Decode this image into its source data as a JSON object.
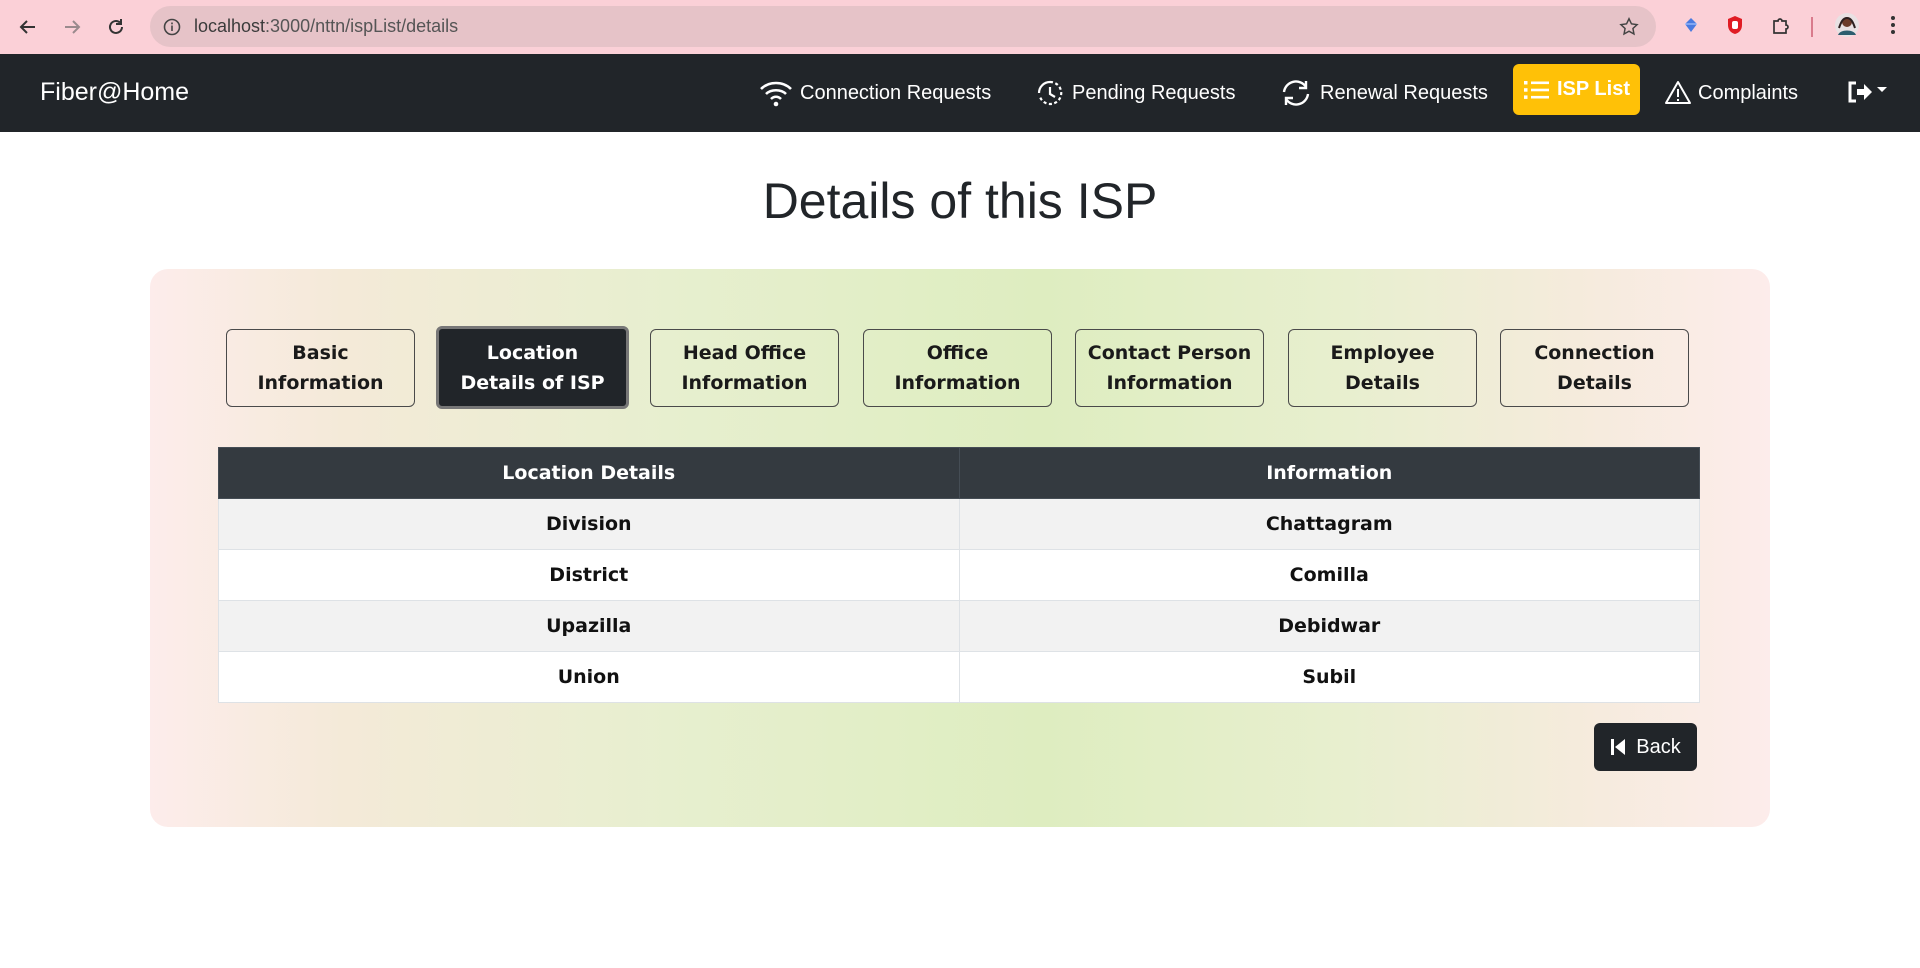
{
  "browser": {
    "url_host": "localhost",
    "url_rest": ":3000/nttn/ispList/details"
  },
  "navbar": {
    "brand": "Fiber@Home",
    "items": [
      {
        "label": "Connection Requests",
        "icon": "wifi-icon"
      },
      {
        "label": "Pending Requests",
        "icon": "clock-history-icon"
      },
      {
        "label": "Renewal Requests",
        "icon": "refresh-icon"
      },
      {
        "label": "ISP List",
        "icon": "list-icon",
        "active": true
      },
      {
        "label": "Complaints",
        "icon": "warning-icon"
      }
    ],
    "active_color": "#ffc107"
  },
  "page": {
    "title": "Details of this ISP"
  },
  "tabs": [
    {
      "line1": "Basic",
      "line2": "Information"
    },
    {
      "line1": "Location",
      "line2": "Details of ISP",
      "active": true
    },
    {
      "line1": "Head Office",
      "line2": "Information"
    },
    {
      "line1": "Office",
      "line2": "Information"
    },
    {
      "line1": "Contact Person",
      "line2": "Information"
    },
    {
      "line1": "Employee",
      "line2": "Details"
    },
    {
      "line1": "Connection",
      "line2": "Details"
    }
  ],
  "table": {
    "headers": [
      "Location Details",
      "Information"
    ],
    "rows": [
      [
        "Division",
        "Chattagram"
      ],
      [
        "District",
        "Comilla"
      ],
      [
        "Upazilla",
        "Debidwar"
      ],
      [
        "Union",
        "Subil"
      ]
    ]
  },
  "back_button": {
    "label": "Back"
  }
}
